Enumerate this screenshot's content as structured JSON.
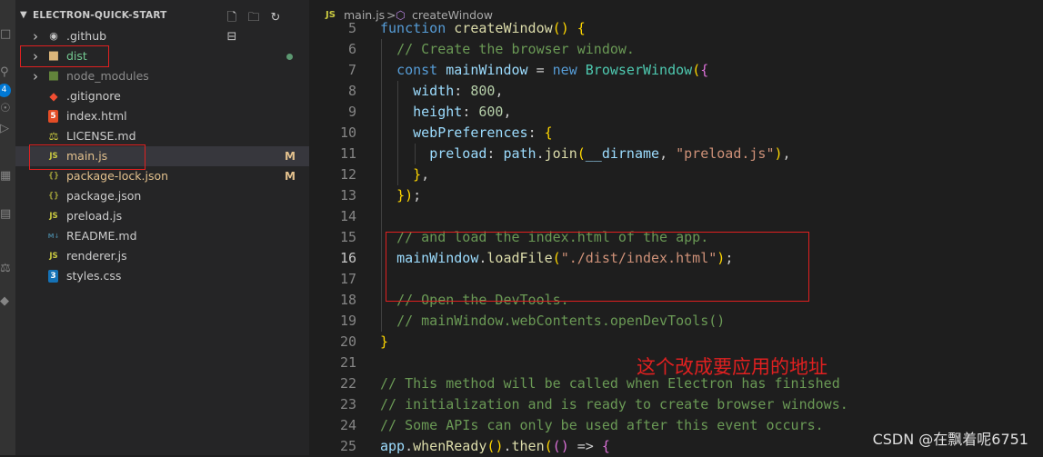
{
  "activity_bar": {
    "items": [
      "files-icon",
      "search-icon",
      "source-control-icon",
      "run-icon",
      "extensions-icon",
      "remote-icon",
      "testing-icon",
      "accounts-icon"
    ],
    "source_control_badge": "4"
  },
  "explorer": {
    "title": "ELECTRON-QUICK-START",
    "tree": [
      {
        "name": ".github",
        "type": "folder",
        "icon": "folder-github-icon",
        "color": "#cccccc",
        "badge": ""
      },
      {
        "name": "dist",
        "type": "folder",
        "icon": "folder-icon",
        "color": "#73c991",
        "badge": "dot"
      },
      {
        "name": "node_modules",
        "type": "folder",
        "icon": "folder-node-icon",
        "color": "#8c8c8c",
        "badge": ""
      },
      {
        "name": ".gitignore",
        "type": "file",
        "icon": "git-icon",
        "color": "#cccccc",
        "badge": ""
      },
      {
        "name": "index.html",
        "type": "file",
        "icon": "html-icon",
        "color": "#cccccc",
        "badge": ""
      },
      {
        "name": "LICENSE.md",
        "type": "file",
        "icon": "license-icon",
        "color": "#cccccc",
        "badge": ""
      },
      {
        "name": "main.js",
        "type": "file",
        "icon": "js-icon",
        "color": "#e2c08d",
        "badge": "M"
      },
      {
        "name": "package-lock.json",
        "type": "file",
        "icon": "json-icon",
        "color": "#e2c08d",
        "badge": "M"
      },
      {
        "name": "package.json",
        "type": "file",
        "icon": "json-icon",
        "color": "#cccccc",
        "badge": ""
      },
      {
        "name": "preload.js",
        "type": "file",
        "icon": "js-icon",
        "color": "#cccccc",
        "badge": ""
      },
      {
        "name": "README.md",
        "type": "file",
        "icon": "markdown-icon",
        "color": "#cccccc",
        "badge": ""
      },
      {
        "name": "renderer.js",
        "type": "file",
        "icon": "js-icon",
        "color": "#cccccc",
        "badge": ""
      },
      {
        "name": "styles.css",
        "type": "file",
        "icon": "css-icon",
        "color": "#cccccc",
        "badge": ""
      }
    ]
  },
  "breadcrumb": {
    "file_icon": "JS",
    "file": "main.js",
    "separator": ">",
    "symbol": "createWindow"
  },
  "code": {
    "active_line": "16",
    "lines": [
      {
        "n": "5",
        "text": "function createWindow() {"
      },
      {
        "n": "6",
        "text": "  // Create the browser window."
      },
      {
        "n": "7",
        "text": "  const mainWindow = new BrowserWindow({"
      },
      {
        "n": "8",
        "text": "    width: 800,"
      },
      {
        "n": "9",
        "text": "    height: 600,"
      },
      {
        "n": "10",
        "text": "    webPreferences: {"
      },
      {
        "n": "11",
        "text": "      preload: path.join(__dirname, \"preload.js\"),"
      },
      {
        "n": "12",
        "text": "    },"
      },
      {
        "n": "13",
        "text": "  });"
      },
      {
        "n": "14",
        "text": ""
      },
      {
        "n": "15",
        "text": "  // and load the index.html of the app."
      },
      {
        "n": "16",
        "text": "  mainWindow.loadFile(\"./dist/index.html\");"
      },
      {
        "n": "17",
        "text": ""
      },
      {
        "n": "18",
        "text": "  // Open the DevTools."
      },
      {
        "n": "19",
        "text": "  // mainWindow.webContents.openDevTools()"
      },
      {
        "n": "20",
        "text": "}"
      },
      {
        "n": "21",
        "text": ""
      },
      {
        "n": "22",
        "text": "// This method will be called when Electron has finished"
      },
      {
        "n": "23",
        "text": "// initialization and is ready to create browser windows."
      },
      {
        "n": "24",
        "text": "// Some APIs can only be used after this event occurs."
      },
      {
        "n": "25",
        "text": "app.whenReady().then(() => {"
      }
    ]
  },
  "annotation": "这个改成要应用的地址",
  "watermark": "CSDN @在飘着呢6751",
  "colors": {
    "highlight_box": "#e02020",
    "modified": "#e2c08d",
    "untracked": "#73c991"
  }
}
